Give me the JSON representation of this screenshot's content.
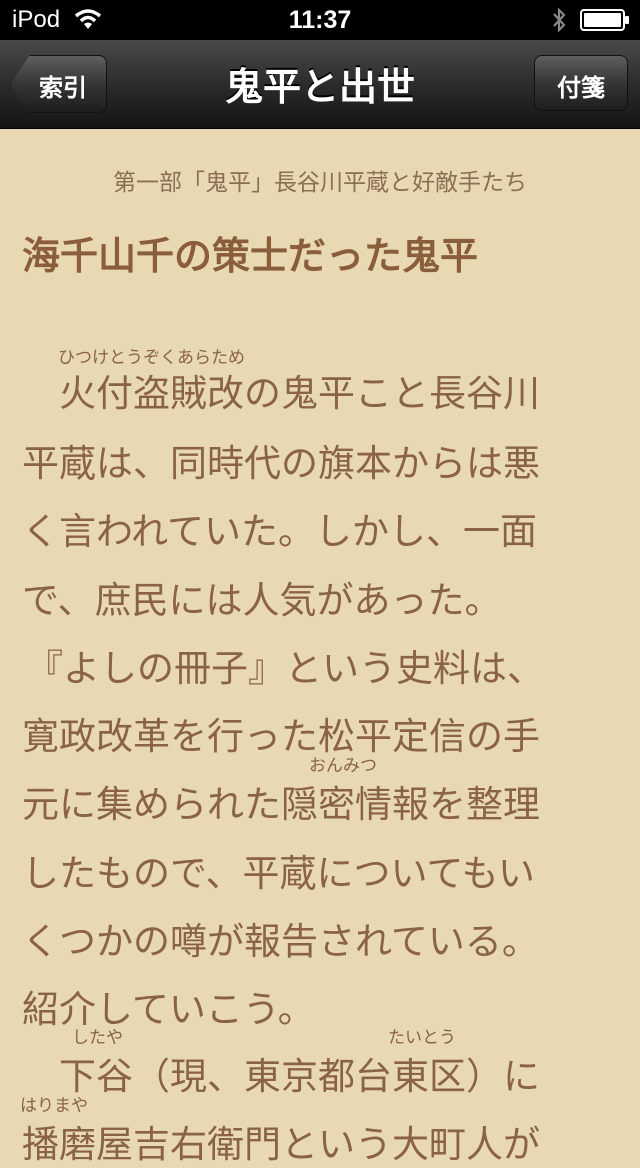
{
  "status_bar": {
    "carrier": "iPod",
    "time": "11:37"
  },
  "nav": {
    "back_label": "索引",
    "title": "鬼平と出世",
    "bookmark_label": "付箋"
  },
  "article": {
    "section": "第一部「鬼平」長谷川平蔵と好敵手たち",
    "title": "海千山千の策士だった鬼平",
    "ruby": [
      "ひつけとうぞくあらため",
      "おんみつ",
      "したや",
      "たいとう",
      "はりまや"
    ],
    "lines": [
      "火付盗賊改の鬼平こと長谷川",
      "平蔵は、同時代の旗本からは悪",
      "く言われていた。しかし、一面",
      "で、庶民には人気があった。",
      "『よしの冊子』という史料は、",
      "寛政改革を行った松平定信の手",
      "元に集められた隠密情報を整理",
      "したもので、平蔵についてもい",
      "くつかの噂が報告されている。",
      "紹介していこう。",
      "下谷（現、東京都台東区）に",
      "播磨屋吉右衛門という大町人が"
    ]
  }
}
